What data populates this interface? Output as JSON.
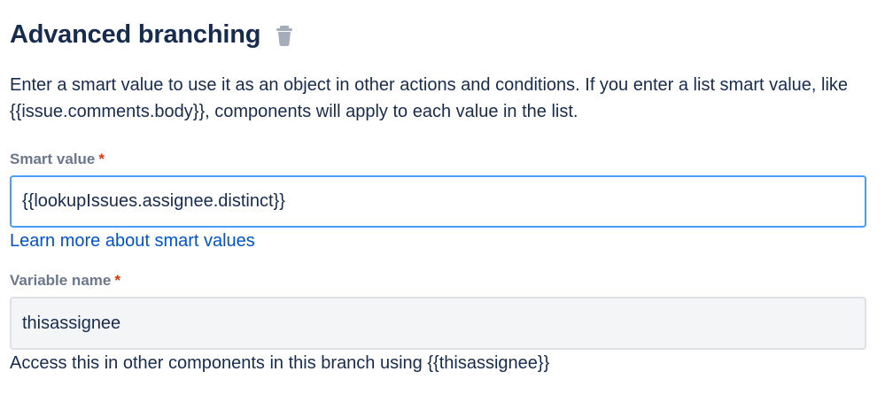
{
  "section": {
    "title": "Advanced branching",
    "delete_icon": "trash-icon",
    "description": "Enter a smart value to use it as an object in other actions and conditions. If you enter a list smart value, like {{issue.comments.body}}, components will apply to each value in the list."
  },
  "smart_value": {
    "label": "Smart value",
    "required_marker": "*",
    "value": "{{lookupIssues.assignee.distinct}}",
    "learn_more_link": "Learn more about smart values"
  },
  "variable_name": {
    "label": "Variable name",
    "required_marker": "*",
    "value": "thisassignee",
    "help_text": "Access this in other components in this branch using {{thisassignee}}"
  },
  "colors": {
    "heading": "#172b4d",
    "label": "#6b778c",
    "required": "#de350b",
    "link": "#0052cc",
    "focus_border": "#4c9aff",
    "input_border": "#dfe1e6",
    "input_background": "#f4f5f7"
  }
}
